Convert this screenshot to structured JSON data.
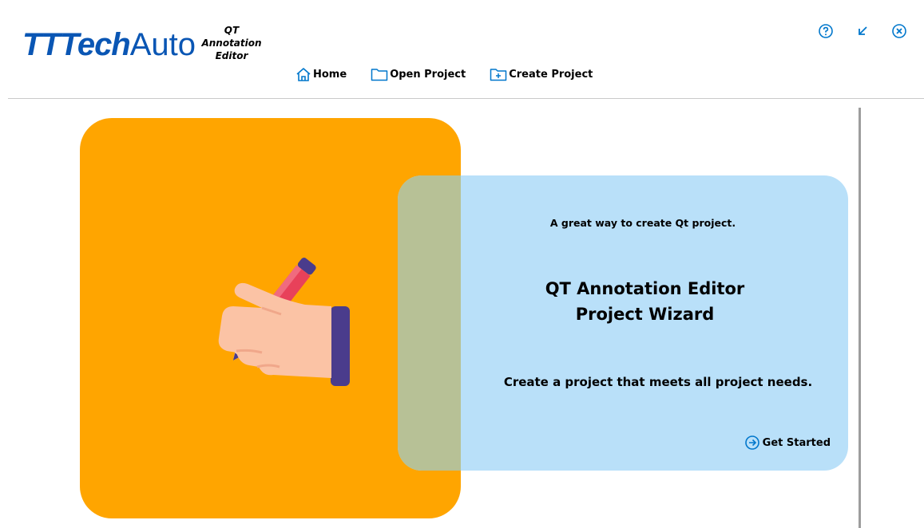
{
  "brand": {
    "part1": "TTTech",
    "part2": "Auto"
  },
  "app_title": {
    "line1": "QT",
    "line2": "Annotation",
    "line3": "Editor"
  },
  "nav": {
    "home": "Home",
    "open_project": "Open Project",
    "create_project": "Create Project"
  },
  "window_controls": [
    "help-icon",
    "minimize-icon",
    "close-icon"
  ],
  "hero": {
    "tagline": "A great way to create Qt project.",
    "title_line1": "QT Annotation Editor",
    "title_line2": "Project Wizard",
    "description": "Create a project that meets all project needs.",
    "cta": "Get Started"
  },
  "colors": {
    "brand_blue": "#0a56b4",
    "orange_panel": "#ffa500",
    "blue_panel": "#b9e0f9",
    "overlap": "#b7c196",
    "icon_blue": "#0077cc"
  }
}
